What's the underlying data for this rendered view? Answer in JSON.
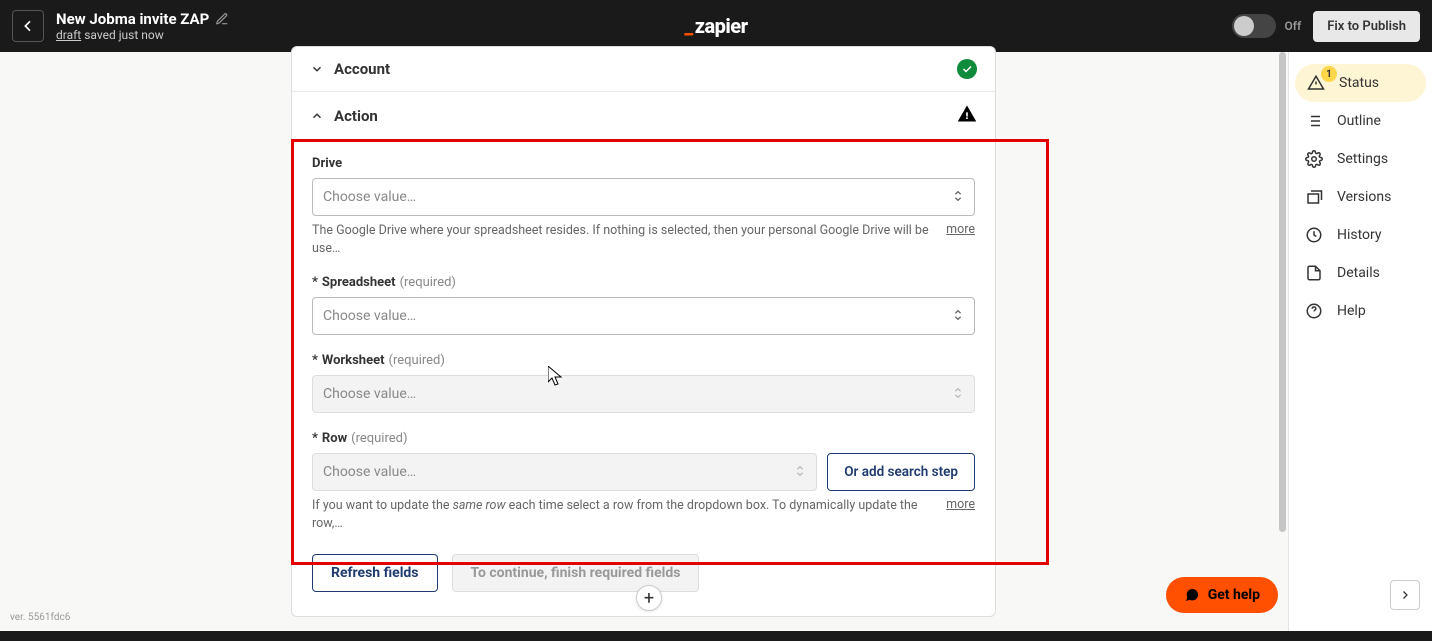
{
  "header": {
    "title": "New Jobma invite ZAP",
    "status_prefix": "draft",
    "status_rest": " saved just now",
    "toggle_label": "Off",
    "publish": "Fix to Publish",
    "logo_text": "zapier"
  },
  "sections": {
    "account": "Account",
    "action": "Action"
  },
  "fields": {
    "drive": {
      "label": "Drive",
      "placeholder": "Choose value…",
      "help": "The Google Drive where your spreadsheet resides. If nothing is selected, then your personal Google Drive will be use…",
      "more": "more"
    },
    "spreadsheet": {
      "label": "Spreadsheet",
      "required": "(required)",
      "placeholder": "Choose value…"
    },
    "worksheet": {
      "label": "Worksheet",
      "required": "(required)",
      "placeholder": "Choose value…"
    },
    "row": {
      "label": "Row",
      "required": "(required)",
      "placeholder": "Choose value…",
      "add_search": "Or add search step",
      "help_a": "If you want to update the ",
      "help_em": "same row",
      "help_b": " each time select a row from the dropdown box. To dynamically update the row,…",
      "more": "more"
    }
  },
  "buttons": {
    "refresh": "Refresh fields",
    "continue": "To continue, finish required fields"
  },
  "right": {
    "status": "Status",
    "status_badge": "1",
    "outline": "Outline",
    "settings": "Settings",
    "versions": "Versions",
    "history": "History",
    "details": "Details",
    "help": "Help"
  },
  "gethelp": "Get help",
  "version": "ver. 5561fdc6"
}
